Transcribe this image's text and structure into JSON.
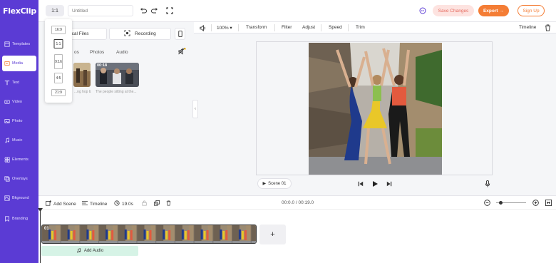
{
  "app": {
    "logo": "FlexClip"
  },
  "sidebar": {
    "items": [
      {
        "label": "Templates",
        "icon": "templates-icon"
      },
      {
        "label": "Media",
        "icon": "media-icon",
        "active": true
      },
      {
        "label": "Text",
        "icon": "text-icon"
      },
      {
        "label": "Video",
        "icon": "video-icon"
      },
      {
        "label": "Photo",
        "icon": "photo-icon"
      },
      {
        "label": "Music",
        "icon": "music-icon"
      },
      {
        "label": "Elements",
        "icon": "elements-icon"
      },
      {
        "label": "Overlays",
        "icon": "overlays-icon"
      },
      {
        "label": "Bkground",
        "icon": "background-icon"
      },
      {
        "label": "Branding",
        "icon": "branding-icon"
      }
    ],
    "bg_color": "#5b3bd4"
  },
  "topbar": {
    "ratio": "1:1",
    "title_placeholder": "Untitled",
    "save_label": "Save Changes",
    "export_label": "Export",
    "signup_label": "Sign Up"
  },
  "ratio_menu": {
    "options": [
      "16:9",
      "1:1",
      "9:16",
      "4:5",
      "21:9"
    ],
    "selected": "1:1"
  },
  "media_panel": {
    "upload_label": "Local Files",
    "record_label": "Recording",
    "tabs": [
      "Videos",
      "Photos",
      "Audio"
    ],
    "tab_visible_fragment": "os",
    "thumbs": [
      {
        "duration": "",
        "caption": "...ng hop ti..."
      },
      {
        "duration": "00:18",
        "caption": "The people sitting at the..."
      }
    ]
  },
  "edit_toolbar": {
    "zoom": "100%",
    "items": [
      "Transform",
      "Filter",
      "Adjust",
      "Speed",
      "Trim"
    ],
    "timeline_label": "Timeline"
  },
  "preview": {
    "scene_label": "Scene 01"
  },
  "timeline_bar": {
    "add_scene": "Add Scene",
    "timeline": "Timeline",
    "duration": "19.0s",
    "time": "00:0.0 / 00:19.0"
  },
  "timeline": {
    "clip_number": "01",
    "add_audio": "Add Audio"
  },
  "colors": {
    "accent": "#5b3bd4",
    "export": "#f47d35",
    "save_bg": "#fde3e0",
    "audio_track": "#d6f3e6"
  }
}
